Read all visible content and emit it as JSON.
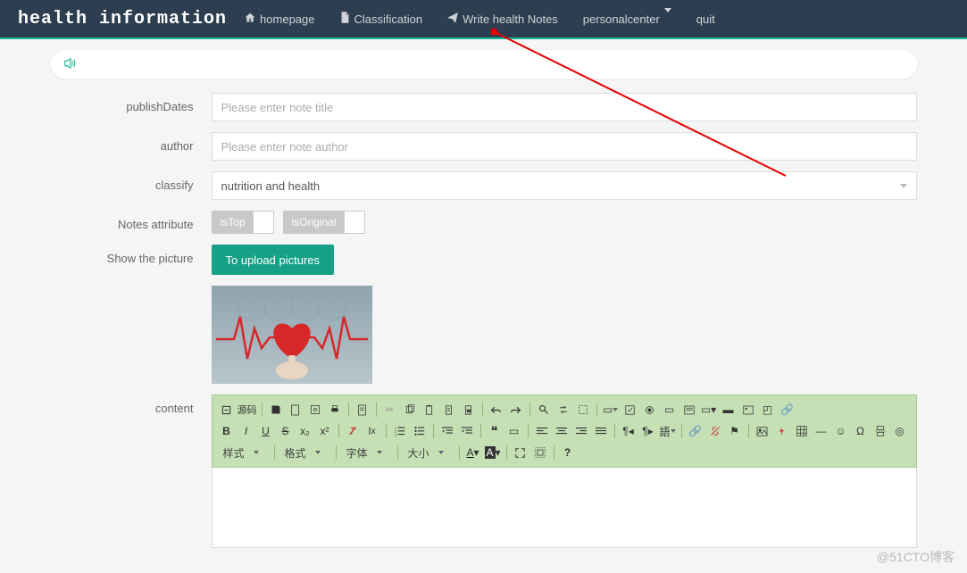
{
  "brand": "health information",
  "nav": {
    "homepage": "homepage",
    "classification": "Classification",
    "write": "Write health Notes",
    "personal": "personalcenter",
    "quit": "quit"
  },
  "form": {
    "publishDates": {
      "label": "publishDates",
      "placeholder": "Please enter note title"
    },
    "author": {
      "label": "author",
      "placeholder": "Please enter note author"
    },
    "classify": {
      "label": "classify",
      "selected": "nutrition and health"
    },
    "notesAttr": {
      "label": "Notes attribute",
      "isTop": "isTop",
      "isOriginal": "isOriginal"
    },
    "showPic": {
      "label": "Show the picture",
      "button": "To upload pictures"
    },
    "content": {
      "label": "content"
    }
  },
  "editor": {
    "source": "源码",
    "styles": "样式",
    "format": "格式",
    "font": "字体",
    "size": "大小"
  },
  "watermark": "@51CTO博客"
}
